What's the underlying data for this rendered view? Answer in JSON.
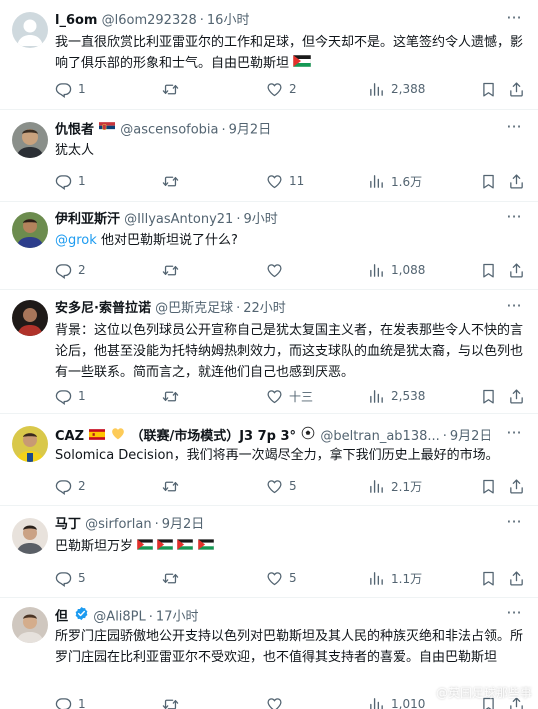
{
  "tweets": [
    {
      "display_name": "l_6om",
      "handle": "@l6om292328",
      "time": "16小时",
      "text": "我一直很欣赏比利亚雷亚尔的工作和足球，但今天却不是。这笔签约令人遗憾，影响了俱乐部的形象和士气。自由巴勒斯坦",
      "replies": "1",
      "retweets": "",
      "likes": "2",
      "views": "2,388"
    },
    {
      "display_name": "仇恨者",
      "handle": "@ascensofobia",
      "time": "9月2日",
      "text": "犹太人",
      "replies": "1",
      "retweets": "",
      "likes": "11",
      "views": "1.6万"
    },
    {
      "display_name": "伊利亚斯汗",
      "handle": "@IllyasAntony21",
      "time": "9小时",
      "mention": "@grok",
      "text": "他对巴勒斯坦说了什么?",
      "replies": "2",
      "retweets": "",
      "likes": "",
      "views": "1,088"
    },
    {
      "display_name": "安多尼·索普拉诺",
      "handle": "@巴斯克足球",
      "time": "22小时",
      "text": "背景：这位以色列球员公开宣称自己是犹太复国主义者，在发表那些令人不快的言论后，他甚至没能为托特纳姆热刺效力，而这支球队的血统是犹太裔，与以色列也有一些联系。简而言之，就连他们自己也感到厌恶。",
      "replies": "1",
      "retweets": "",
      "likes": "十三",
      "views": "2,538"
    },
    {
      "display_name": "CAZ",
      "display_name_suffix": "（联赛/市场模式）J3 7p 3°",
      "handle": "@beltran_ab138...",
      "time": "9月2日",
      "text": "Solomica Decision，我们将再一次竭尽全力，拿下我们历史上最好的市场。",
      "replies": "2",
      "retweets": "",
      "likes": "5",
      "views": "2.1万"
    },
    {
      "display_name": "马丁",
      "handle": "@sirforlan",
      "time": "9月2日",
      "text": "巴勒斯坦万岁",
      "replies": "5",
      "retweets": "",
      "likes": "5",
      "views": "1.1万"
    },
    {
      "display_name": "但",
      "handle": "@Ali8PL",
      "time": "17小时",
      "text": "所罗门庄园骄傲地公开支持以色列对巴勒斯坦及其人民的种族灭绝和非法占领。所罗门庄园在比利亚雷亚尔不受欢迎，也不值得其支持者的喜爱。自由巴勒斯坦",
      "replies": "1",
      "retweets": "",
      "likes": "",
      "views": "1,010"
    }
  ],
  "ui": {
    "separator": "·",
    "more": "···"
  },
  "watermark": "@英国足球那些事",
  "colors": {
    "text": "#0f1419",
    "secondary": "#536471",
    "mention": "#1d9bf0",
    "verified": "#1d9bf0",
    "divider": "#eff3f4"
  },
  "icons": [
    "more-icon",
    "reply-icon",
    "retweet-icon",
    "like-icon",
    "views-icon",
    "bookmark-icon",
    "share-icon",
    "verified-icon",
    "palestine-flag-icon",
    "serbia-flag-icon",
    "spain-flag-icon",
    "heart-emoji-icon",
    "soccer-ball-icon",
    "weibo-icon"
  ]
}
